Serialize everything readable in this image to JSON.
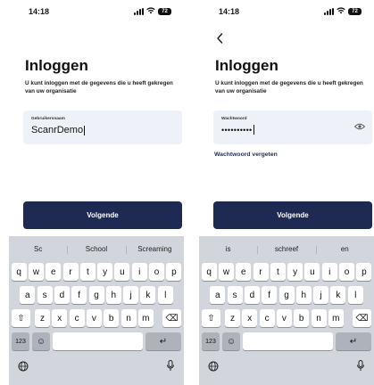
{
  "status": {
    "time": "14:18",
    "battery": "72"
  },
  "login_username": {
    "title": "Inloggen",
    "subtitle": "U kunt inloggen met de gegevens die u heeft gekregen van uw organisatie",
    "field_label": "Gebruikersnaam",
    "field_value": "ScanrDemo",
    "button_label": "Volgende",
    "suggestions": [
      "Sc",
      "School",
      "Screaming"
    ]
  },
  "login_password": {
    "back_icon": "chevron-left-icon",
    "title": "Inloggen",
    "subtitle": "U kunt inloggen met de gegevens die u heeft gekregen van uw organisatie",
    "field_label": "Wachtwoord",
    "field_value": "••••••••••",
    "eye_icon": "eye-icon",
    "forgot_link": "Wachtwoord vergeten",
    "button_label": "Volgende",
    "suggestions": [
      "is",
      "schreef",
      "en"
    ]
  },
  "keyboard": {
    "row1": [
      "q",
      "w",
      "e",
      "r",
      "t",
      "y",
      "u",
      "i",
      "o",
      "p"
    ],
    "row2": [
      "a",
      "s",
      "d",
      "f",
      "g",
      "h",
      "j",
      "k",
      "l"
    ],
    "row3": [
      "z",
      "x",
      "c",
      "v",
      "b",
      "n",
      "m"
    ],
    "shift_icon": "⇧",
    "delete_icon": "⌫",
    "numbers_key": "123",
    "emoji_icon": "☺",
    "space_hint": "",
    "return_icon": "↵",
    "globe_icon": "globe-icon",
    "mic_icon": "mic-icon"
  },
  "colors": {
    "primary": "#1e2a52",
    "field_bg": "#eef2f8",
    "keyboard_bg": "#d2d5db"
  }
}
